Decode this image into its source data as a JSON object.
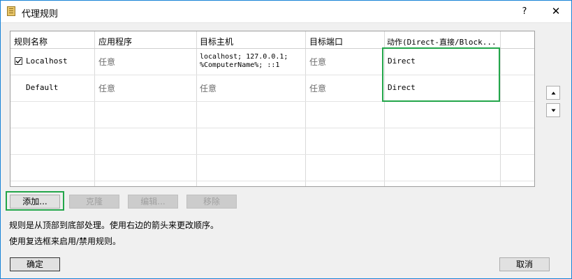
{
  "window": {
    "title": "代理规则",
    "help_label": "?",
    "close_label": "✕"
  },
  "table": {
    "columns": [
      "规则名称",
      "应用程序",
      "目标主机",
      "目标端口",
      "动作(Direct-直接/Block..."
    ],
    "rows": [
      {
        "checked": true,
        "name": "Localhost",
        "application": "任意",
        "target_host_line1": "localhost; 127.0.0.1;",
        "target_host_line2": "%ComputerName%; ::1",
        "target_port": "任意",
        "action": "Direct"
      },
      {
        "checked": false,
        "name": "Default",
        "application": "任意",
        "target_host": "任意",
        "target_port": "任意",
        "action": "Direct"
      }
    ]
  },
  "buttons": {
    "add": "添加...",
    "clone": "克隆",
    "edit": "编辑...",
    "remove": "移除",
    "ok": "确定",
    "cancel": "取消"
  },
  "info": {
    "line1": "规则是从顶部到底部处理。使用右边的箭头来更改顺序。",
    "line2": "使用复选框来启用/禁用规则。"
  },
  "icons": {
    "app": "app-rules-icon",
    "move_up": "triangle-up-icon",
    "move_down": "triangle-down-icon",
    "checkbox": "checkmark-icon"
  },
  "colors": {
    "highlight": "#23a64a",
    "border": "#1883d7"
  }
}
